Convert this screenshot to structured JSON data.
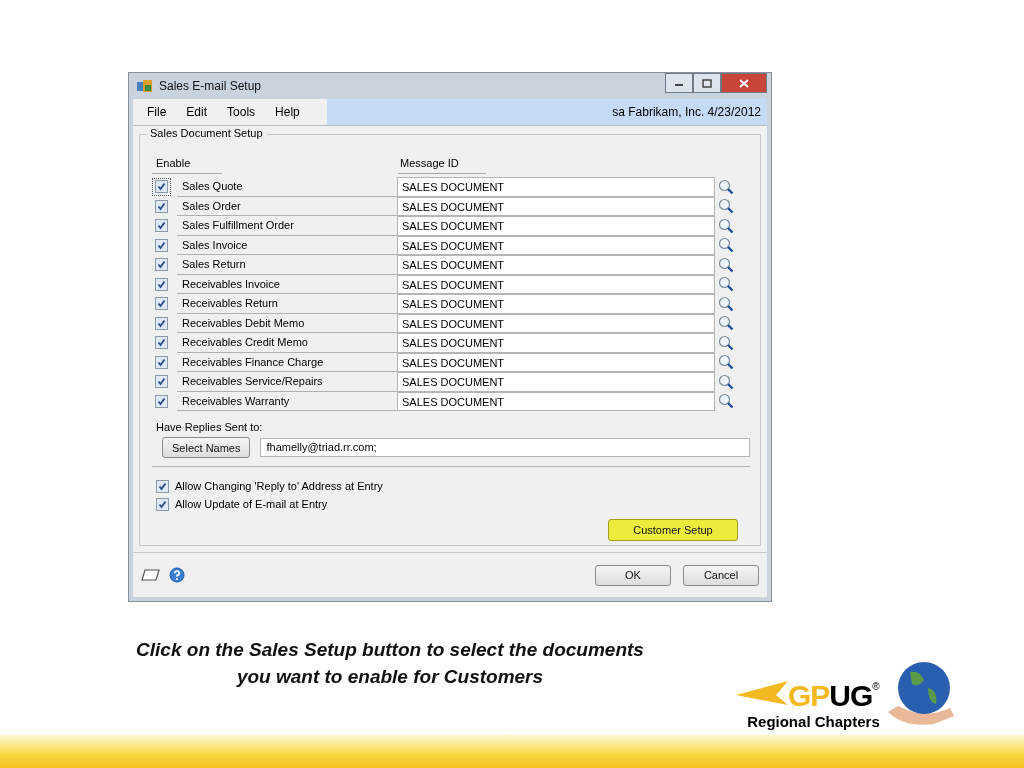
{
  "window": {
    "title": "Sales E-mail Setup"
  },
  "menu": [
    {
      "label": "File"
    },
    {
      "label": "Edit"
    },
    {
      "label": "Tools"
    },
    {
      "label": "Help"
    }
  ],
  "user_info": "sa  Fabrikam, Inc.  4/23/2012",
  "group": {
    "title": "Sales Document Setup",
    "enable_header": "Enable",
    "message_header": "Message ID",
    "rows": [
      {
        "label": "Sales Quote",
        "checked": true,
        "focused": true,
        "message_id": "SALES DOCUMENT"
      },
      {
        "label": "Sales Order",
        "checked": true,
        "focused": false,
        "message_id": "SALES DOCUMENT"
      },
      {
        "label": "Sales Fulfillment Order",
        "checked": true,
        "focused": false,
        "message_id": "SALES DOCUMENT"
      },
      {
        "label": "Sales Invoice",
        "checked": true,
        "focused": false,
        "message_id": "SALES DOCUMENT"
      },
      {
        "label": "Sales Return",
        "checked": true,
        "focused": false,
        "message_id": "SALES DOCUMENT"
      },
      {
        "label": "Receivables Invoice",
        "checked": true,
        "focused": false,
        "message_id": "SALES DOCUMENT"
      },
      {
        "label": "Receivables Return",
        "checked": true,
        "focused": false,
        "message_id": "SALES DOCUMENT"
      },
      {
        "label": "Receivables Debit Memo",
        "checked": true,
        "focused": false,
        "message_id": "SALES DOCUMENT"
      },
      {
        "label": "Receivables Credit Memo",
        "checked": true,
        "focused": false,
        "message_id": "SALES DOCUMENT"
      },
      {
        "label": "Receivables Finance Charge",
        "checked": true,
        "focused": false,
        "message_id": "SALES DOCUMENT"
      },
      {
        "label": "Receivables Service/Repairs",
        "checked": true,
        "focused": false,
        "message_id": "SALES DOCUMENT"
      },
      {
        "label": "Receivables Warranty",
        "checked": true,
        "focused": false,
        "message_id": "SALES DOCUMENT"
      }
    ],
    "replies_label": "Have Replies Sent to:",
    "select_names_button": "Select Names",
    "reply_address": "fhamelly@triad.rr.com;",
    "options": [
      {
        "label": "Allow Changing 'Reply to' Address at Entry",
        "checked": true
      },
      {
        "label": "Allow Update of E-mail at Entry",
        "checked": true
      }
    ],
    "customer_setup_button": {
      "label": "Customer Setup",
      "highlighted": true
    }
  },
  "footer_buttons": [
    "OK",
    "Cancel"
  ],
  "caption": [
    "Click on the Sales Setup button to select the documents",
    "you want to enable for Customers"
  ],
  "logo": {
    "mark_first": "GP",
    "mark_second": "UG",
    "registered": "®",
    "subtitle": "Regional Chapters"
  }
}
